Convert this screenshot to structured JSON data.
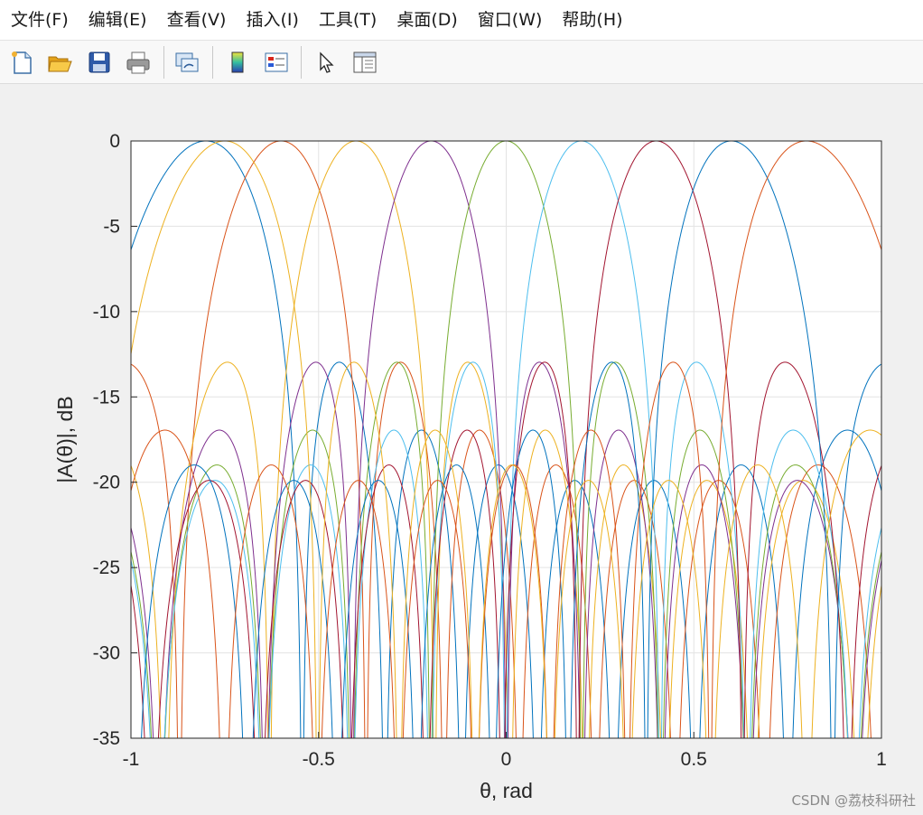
{
  "menubar": {
    "items": [
      {
        "label": "文件(F)"
      },
      {
        "label": "编辑(E)"
      },
      {
        "label": "查看(V)"
      },
      {
        "label": "插入(I)"
      },
      {
        "label": "工具(T)"
      },
      {
        "label": "桌面(D)"
      },
      {
        "label": "窗口(W)"
      },
      {
        "label": "帮助(H)"
      }
    ]
  },
  "toolbar": {
    "buttons": [
      {
        "icon": "new-figure-icon"
      },
      {
        "icon": "open-file-icon"
      },
      {
        "icon": "save-icon"
      },
      {
        "icon": "print-icon"
      },
      {
        "icon": "link-plot-icon"
      },
      {
        "icon": "insert-colorbar-icon"
      },
      {
        "icon": "insert-legend-icon"
      },
      {
        "icon": "edit-plot-icon"
      },
      {
        "icon": "property-inspector-icon"
      }
    ]
  },
  "chart_data": {
    "type": "line",
    "title": "",
    "xlabel": "θ, rad",
    "ylabel": "|A(θ)|, dB",
    "xlim": [
      -1,
      1
    ],
    "ylim": [
      -35,
      0
    ],
    "xticks": [
      -1,
      -0.5,
      0,
      0.5,
      1
    ],
    "xtick_labels": [
      "-1",
      "-0.5",
      "0",
      "0.5",
      "1"
    ],
    "yticks": [
      0,
      -5,
      -10,
      -15,
      -20,
      -25,
      -30,
      -35
    ],
    "ytick_labels": [
      "0",
      "-5",
      "-10",
      "-15",
      "-20",
      "-25",
      "-30",
      "-35"
    ],
    "grid": true,
    "legend": "none",
    "array_elements": 10,
    "series": [
      {
        "peak": -0.8,
        "color": "#0072BD"
      },
      {
        "peak": -0.6,
        "color": "#D95319"
      },
      {
        "peak": -0.4,
        "color": "#EDB120"
      },
      {
        "peak": -0.2,
        "color": "#7E2F8E"
      },
      {
        "peak": 0.0,
        "color": "#77AC30"
      },
      {
        "peak": 0.2,
        "color": "#4DBEEE"
      },
      {
        "peak": 0.4,
        "color": "#A2142F"
      },
      {
        "peak": 0.6,
        "color": "#0072BD"
      },
      {
        "peak": 0.8,
        "color": "#D95319"
      },
      {
        "peak": -0.8,
        "color": "#EDB120",
        "offset": 0.05
      }
    ]
  },
  "watermark": "CSDN @荔枝科研社"
}
